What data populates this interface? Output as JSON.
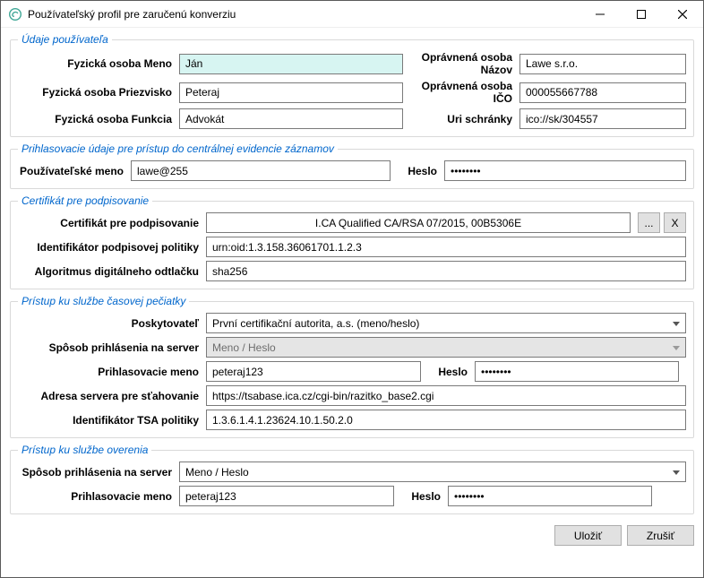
{
  "window": {
    "title": "Používateľský profil pre zaručenú konverziu"
  },
  "groups": {
    "user": {
      "legend": "Údaje používateľa",
      "labels": {
        "first_name": "Fyzická osoba Meno",
        "last_name": "Fyzická osoba Priezvisko",
        "function": "Fyzická osoba Funkcia",
        "auth_name": "Oprávnená osoba Názov",
        "auth_ico": "Oprávnená osoba IČO",
        "uri": "Uri schránky"
      },
      "values": {
        "first_name": "Ján",
        "last_name": "Peteraj",
        "function": "Advokát",
        "auth_name": "Lawe s.r.o.",
        "auth_ico": "000055667788",
        "uri": "ico://sk/304557"
      }
    },
    "login": {
      "legend": "Prihlasovacie údaje pre prístup do centrálnej evidencie záznamov",
      "labels": {
        "username": "Používateľské meno",
        "password": "Heslo"
      },
      "values": {
        "username": "lawe@255",
        "password": "********"
      }
    },
    "cert": {
      "legend": "Certifikát pre podpisovanie",
      "labels": {
        "cert": "Certifikát pre podpisovanie",
        "policy_id": "Identifikátor podpisovej politiky",
        "digest_alg": "Algoritmus digitálneho odtlačku"
      },
      "values": {
        "cert": "I.CA Qualified CA/RSA 07/2015, 00B5306E",
        "policy_id": "urn:oid:1.3.158.36061701.1.2.3",
        "digest_alg": "sha256"
      },
      "buttons": {
        "browse": "...",
        "clear": "X"
      }
    },
    "tsa": {
      "legend": "Prístup ku službe časovej pečiatky",
      "labels": {
        "provider": "Poskytovateľ",
        "login_method": "Spôsob prihlásenia na server",
        "login_name": "Prihlasovacie meno",
        "password": "Heslo",
        "server": "Adresa servera pre sťahovanie",
        "tsa_policy": "Identifikátor TSA politiky"
      },
      "values": {
        "provider": "První certifikační autorita, a.s. (meno/heslo)",
        "login_method": "Meno / Heslo",
        "login_name": "peteraj123",
        "password": "********",
        "server": "https://tsabase.ica.cz/cgi-bin/razitko_base2.cgi",
        "tsa_policy": "1.3.6.1.4.1.23624.10.1.50.2.0"
      }
    },
    "verify": {
      "legend": "Prístup ku službe overenia",
      "labels": {
        "login_method": "Spôsob prihlásenia na server",
        "login_name": "Prihlasovacie meno",
        "password": "Heslo"
      },
      "values": {
        "login_method": "Meno / Heslo",
        "login_name": "peteraj123",
        "password": "********"
      }
    }
  },
  "footer": {
    "save": "Uložiť",
    "cancel": "Zrušiť"
  }
}
